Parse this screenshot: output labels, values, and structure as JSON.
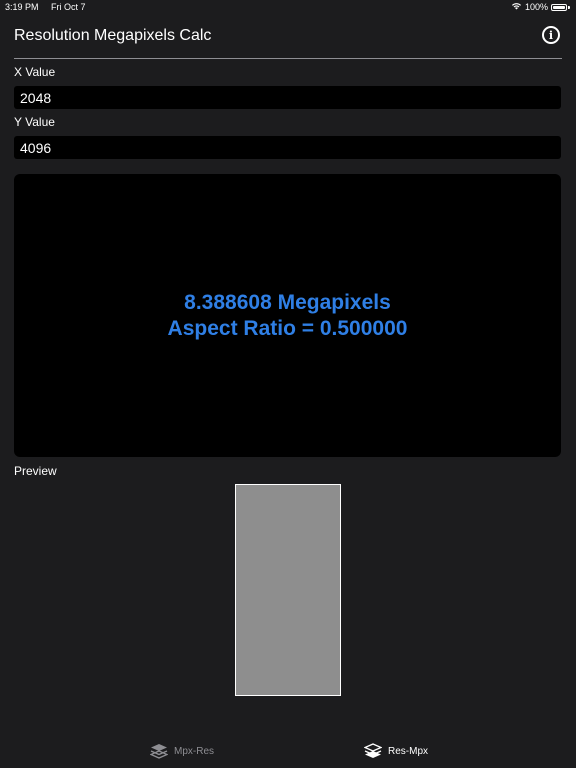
{
  "status": {
    "time": "3:19 PM",
    "date": "Fri Oct 7",
    "battery": "100%"
  },
  "nav": {
    "title": "Resolution Megapixels Calc"
  },
  "form": {
    "x_label": "X Value",
    "x_value": "2048",
    "y_label": "Y Value",
    "y_value": "4096"
  },
  "result": {
    "megapixels_text": "8.388608 Megapixels",
    "aspect_text": "Aspect Ratio = 0.500000",
    "text_color": "#2f7fe5"
  },
  "preview": {
    "label": "Preview",
    "fill_color": "#8e8e8e"
  },
  "tabs": [
    {
      "label": "Mpx-Res",
      "icon": "layers-icon",
      "active": false
    },
    {
      "label": "Res-Mpx",
      "icon": "layers-icon",
      "active": true
    }
  ]
}
